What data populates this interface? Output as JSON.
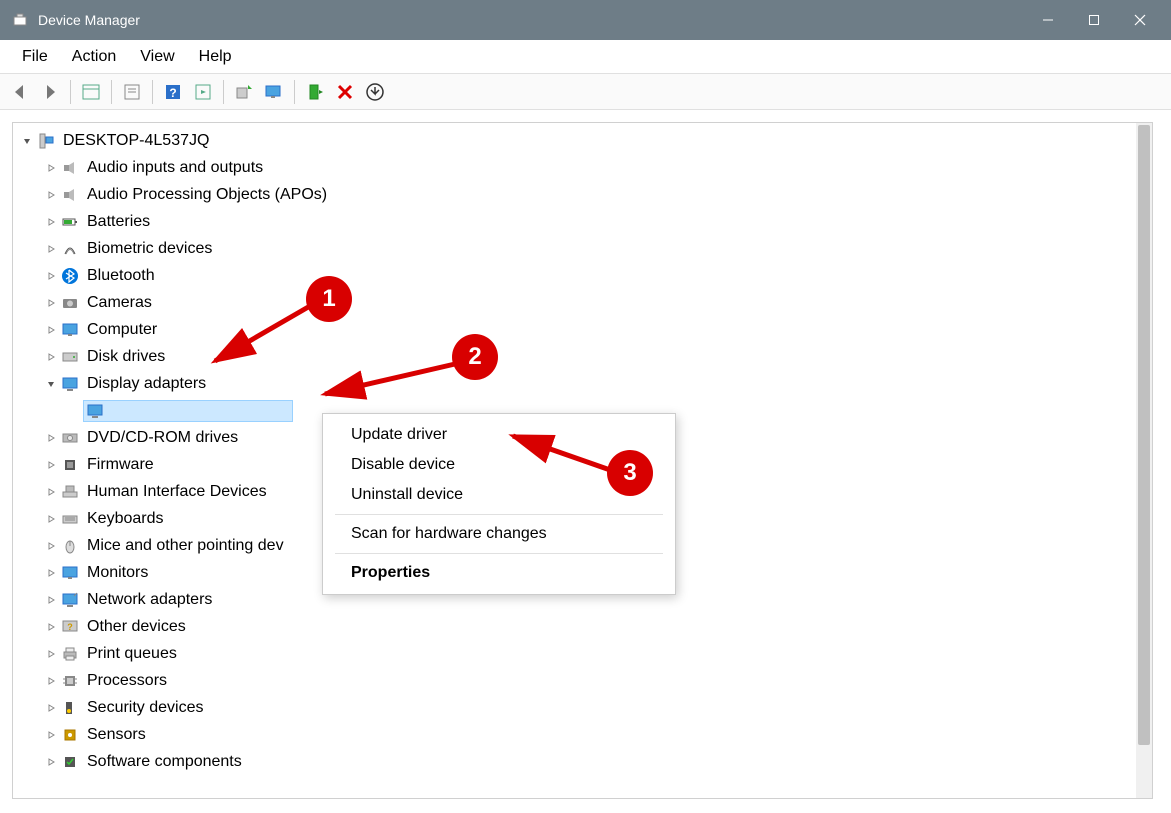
{
  "title": "Device Manager",
  "menus": {
    "file": "File",
    "action": "Action",
    "view": "View",
    "help": "Help"
  },
  "root": "DESKTOP-4L537JQ",
  "categories": [
    {
      "id": "audio-io",
      "label": "Audio inputs and outputs",
      "icon": "speaker"
    },
    {
      "id": "audio-apo",
      "label": "Audio Processing Objects (APOs)",
      "icon": "speaker"
    },
    {
      "id": "batteries",
      "label": "Batteries",
      "icon": "battery"
    },
    {
      "id": "biometric",
      "label": "Biometric devices",
      "icon": "fingerprint"
    },
    {
      "id": "bluetooth",
      "label": "Bluetooth",
      "icon": "bluetooth"
    },
    {
      "id": "cameras",
      "label": "Cameras",
      "icon": "camera"
    },
    {
      "id": "computer",
      "label": "Computer",
      "icon": "monitor"
    },
    {
      "id": "disk",
      "label": "Disk drives",
      "icon": "disk"
    },
    {
      "id": "display",
      "label": "Display adapters",
      "icon": "display",
      "expanded": true
    },
    {
      "id": "dvd",
      "label": "DVD/CD-ROM drives",
      "icon": "optical"
    },
    {
      "id": "firmware",
      "label": "Firmware",
      "icon": "chip"
    },
    {
      "id": "hid",
      "label": "Human Interface Devices",
      "icon": "hid"
    },
    {
      "id": "keyboards",
      "label": "Keyboards",
      "icon": "keyboard"
    },
    {
      "id": "mice",
      "label": "Mice and other pointing dev",
      "icon": "mouse"
    },
    {
      "id": "monitors",
      "label": "Monitors",
      "icon": "monitor"
    },
    {
      "id": "network",
      "label": "Network adapters",
      "icon": "network"
    },
    {
      "id": "other",
      "label": "Other devices",
      "icon": "unknown"
    },
    {
      "id": "print",
      "label": "Print queues",
      "icon": "printer"
    },
    {
      "id": "processors",
      "label": "Processors",
      "icon": "cpu"
    },
    {
      "id": "security",
      "label": "Security devices",
      "icon": "security"
    },
    {
      "id": "sensors",
      "label": "Sensors",
      "icon": "sensor"
    },
    {
      "id": "software",
      "label": "Software components",
      "icon": "software"
    }
  ],
  "selected_device": {
    "parent": "display",
    "label": ""
  },
  "context_menu": {
    "items": [
      {
        "id": "update",
        "label": "Update driver"
      },
      {
        "id": "disable",
        "label": "Disable device"
      },
      {
        "id": "uninstall",
        "label": "Uninstall device"
      }
    ],
    "scan": "Scan for hardware changes",
    "properties": "Properties"
  },
  "annotations": {
    "1": "1",
    "2": "2",
    "3": "3"
  }
}
